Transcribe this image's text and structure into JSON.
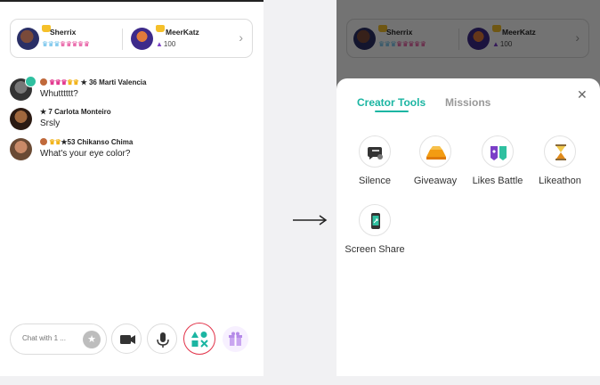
{
  "header": {
    "host1": {
      "name": "Sherrix"
    },
    "host2": {
      "name": "MeerKatz",
      "likes": "100"
    }
  },
  "chat": [
    {
      "header": "36 Marti Valencia",
      "text": "Whutttttt?"
    },
    {
      "header": "★ 7 Carlota Monteiro",
      "text": "Srsly"
    },
    {
      "header": "53 Chikanso Chima",
      "text": "What's your eye color?"
    }
  ],
  "composer": {
    "placeholder": "Chat with 1 ..."
  },
  "sheet": {
    "tabs": [
      "Creator Tools",
      "Missions"
    ],
    "tools": [
      "Silence",
      "Giveaway",
      "Likes Battle",
      "Likeathon",
      "Screen Share"
    ]
  },
  "colors": {
    "accent": "#1bb5a2",
    "highlight": "#e2344a",
    "pink": "#e3398f",
    "blue": "#5bb9e8"
  }
}
